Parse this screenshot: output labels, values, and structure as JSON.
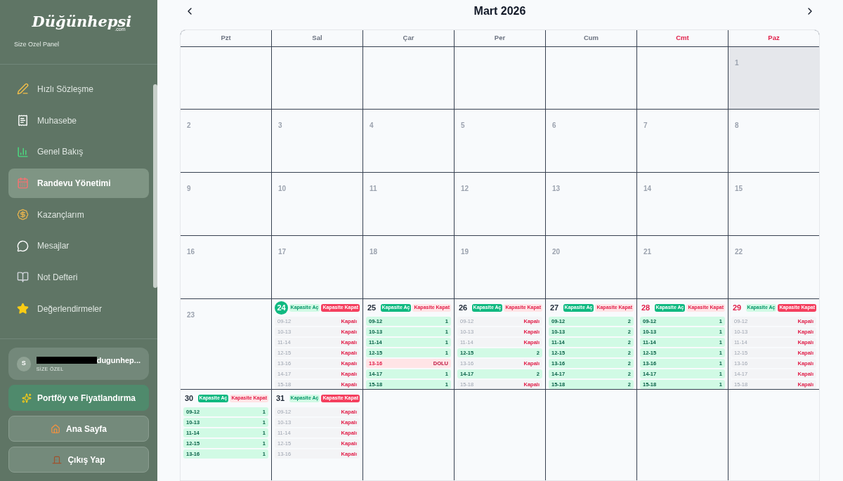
{
  "sidebar": {
    "logo": "Düğünhepsi",
    "logo_suffix": ".com",
    "subtitle": "Size Ozel Panel",
    "items": [
      {
        "label": "Hızlı Sözleşme",
        "kind": "pen",
        "selected": false
      },
      {
        "label": "Muhasebe",
        "kind": "receipt",
        "selected": false
      },
      {
        "label": "Genel Bakış",
        "kind": "chart",
        "selected": false
      },
      {
        "label": "Randevu Yönetimi",
        "kind": "calendar",
        "selected": true
      },
      {
        "label": "Kazançlarım",
        "kind": "money",
        "selected": false
      },
      {
        "label": "Mesajlar",
        "kind": "chat",
        "selected": false
      },
      {
        "label": "Not Defteri",
        "kind": "notebook",
        "selected": false
      },
      {
        "label": "Değerlendirmeler",
        "kind": "star",
        "selected": false
      }
    ],
    "user": {
      "initial": "S",
      "name": "dugunhep...",
      "role": "SİZE ÖZEL"
    },
    "buttons": [
      {
        "label": "Portföy ve Fiyatlandırma",
        "kind": "sparkles",
        "primary": true
      },
      {
        "label": "Ana Sayfa",
        "kind": "home",
        "primary": false
      },
      {
        "label": "Çıkış Yap",
        "kind": "door",
        "primary": false
      }
    ]
  },
  "calendar": {
    "title": "Mart 2026",
    "weekdays": [
      {
        "label": "Pzt",
        "weekend": false
      },
      {
        "label": "Sal",
        "weekend": false
      },
      {
        "label": "Çar",
        "weekend": false
      },
      {
        "label": "Per",
        "weekend": false
      },
      {
        "label": "Cum",
        "weekend": false
      },
      {
        "label": "Cmt",
        "weekend": true
      },
      {
        "label": "Paz",
        "weekend": true
      }
    ],
    "weeks": [
      [
        {
          "kind": "empty"
        },
        {
          "kind": "empty"
        },
        {
          "kind": "empty"
        },
        {
          "kind": "empty"
        },
        {
          "kind": "empty"
        },
        {
          "kind": "empty"
        },
        {
          "kind": "past",
          "day": "1",
          "shaded": true
        }
      ],
      [
        {
          "kind": "past",
          "day": "2",
          "shaded": false
        },
        {
          "kind": "past",
          "day": "3",
          "shaded": false
        },
        {
          "kind": "past",
          "day": "4",
          "shaded": false
        },
        {
          "kind": "past",
          "day": "5",
          "shaded": false
        },
        {
          "kind": "past",
          "day": "6",
          "shaded": false
        },
        {
          "kind": "past",
          "day": "7",
          "shaded": false
        },
        {
          "kind": "past",
          "day": "8",
          "shaded": false
        }
      ],
      [
        {
          "kind": "past",
          "day": "9",
          "shaded": false
        },
        {
          "kind": "past",
          "day": "10",
          "shaded": false
        },
        {
          "kind": "past",
          "day": "11",
          "shaded": false
        },
        {
          "kind": "past",
          "day": "12",
          "shaded": false
        },
        {
          "kind": "past",
          "day": "13",
          "shaded": false
        },
        {
          "kind": "past",
          "day": "14",
          "shaded": false
        },
        {
          "kind": "past",
          "day": "15",
          "shaded": false
        }
      ],
      [
        {
          "kind": "past",
          "day": "16",
          "shaded": false
        },
        {
          "kind": "past",
          "day": "17",
          "shaded": false
        },
        {
          "kind": "past",
          "day": "18",
          "shaded": false
        },
        {
          "kind": "past",
          "day": "19",
          "shaded": false
        },
        {
          "kind": "past",
          "day": "20",
          "shaded": false
        },
        {
          "kind": "past",
          "day": "21",
          "shaded": false
        },
        {
          "kind": "past",
          "day": "22",
          "shaded": false
        }
      ],
      [
        {
          "kind": "past",
          "day": "23",
          "shaded": false
        },
        {
          "kind": "active",
          "day": "24",
          "today": true,
          "weekend": false,
          "buttons": [
            {
              "label": "Kapasite Aç",
              "kind": "open",
              "selected": false
            },
            {
              "label": "Kapasite Kapat",
              "kind": "close",
              "selected": true
            }
          ],
          "slots": [
            {
              "time": "09-12",
              "kind": "closed",
              "value": "Kapalı"
            },
            {
              "time": "10-13",
              "kind": "closed",
              "value": "Kapalı"
            },
            {
              "time": "11-14",
              "kind": "closed",
              "value": "Kapalı"
            },
            {
              "time": "12-15",
              "kind": "closed",
              "value": "Kapalı"
            },
            {
              "time": "13-16",
              "kind": "closed",
              "value": "Kapalı"
            },
            {
              "time": "14-17",
              "kind": "closed",
              "value": "Kapalı"
            },
            {
              "time": "15-18",
              "kind": "closed",
              "value": "Kapalı"
            }
          ]
        },
        {
          "kind": "active",
          "day": "25",
          "today": false,
          "weekend": false,
          "buttons": [
            {
              "label": "Kapasite Aç",
              "kind": "open",
              "selected": true
            },
            {
              "label": "Kapasite Kapat",
              "kind": "close",
              "selected": false
            }
          ],
          "slots": [
            {
              "time": "09-12",
              "kind": "open",
              "value": "1"
            },
            {
              "time": "10-13",
              "kind": "open",
              "value": "1"
            },
            {
              "time": "11-14",
              "kind": "open",
              "value": "1"
            },
            {
              "time": "12-15",
              "kind": "open",
              "value": "1"
            },
            {
              "time": "13-16",
              "kind": "full",
              "value": "DOLU"
            },
            {
              "time": "14-17",
              "kind": "open",
              "value": "1"
            },
            {
              "time": "15-18",
              "kind": "open",
              "value": "1"
            }
          ]
        },
        {
          "kind": "active",
          "day": "26",
          "today": false,
          "weekend": false,
          "buttons": [
            {
              "label": "Kapasite Aç",
              "kind": "open",
              "selected": true
            },
            {
              "label": "Kapasite Kapat",
              "kind": "close",
              "selected": false
            }
          ],
          "slots": [
            {
              "time": "09-12",
              "kind": "closed",
              "value": "Kapalı"
            },
            {
              "time": "10-13",
              "kind": "closed",
              "value": "Kapalı"
            },
            {
              "time": "11-14",
              "kind": "closed",
              "value": "Kapalı"
            },
            {
              "time": "12-15",
              "kind": "open",
              "value": "2"
            },
            {
              "time": "13-16",
              "kind": "closed",
              "value": "Kapalı"
            },
            {
              "time": "14-17",
              "kind": "open",
              "value": "2"
            },
            {
              "time": "15-18",
              "kind": "closed",
              "value": "Kapalı"
            }
          ]
        },
        {
          "kind": "active",
          "day": "27",
          "today": false,
          "weekend": false,
          "buttons": [
            {
              "label": "Kapasite Aç",
              "kind": "open",
              "selected": true
            },
            {
              "label": "Kapasite Kapat",
              "kind": "close",
              "selected": false
            }
          ],
          "slots": [
            {
              "time": "09-12",
              "kind": "open",
              "value": "2"
            },
            {
              "time": "10-13",
              "kind": "open",
              "value": "2"
            },
            {
              "time": "11-14",
              "kind": "open",
              "value": "2"
            },
            {
              "time": "12-15",
              "kind": "open",
              "value": "2"
            },
            {
              "time": "13-16",
              "kind": "open",
              "value": "2"
            },
            {
              "time": "14-17",
              "kind": "open",
              "value": "2"
            },
            {
              "time": "15-18",
              "kind": "open",
              "value": "2"
            }
          ]
        },
        {
          "kind": "active",
          "day": "28",
          "today": false,
          "weekend": true,
          "buttons": [
            {
              "label": "Kapasite Aç",
              "kind": "open",
              "selected": true
            },
            {
              "label": "Kapasite Kapat",
              "kind": "close",
              "selected": false
            }
          ],
          "slots": [
            {
              "time": "09-12",
              "kind": "open",
              "value": "1"
            },
            {
              "time": "10-13",
              "kind": "open",
              "value": "1"
            },
            {
              "time": "11-14",
              "kind": "open",
              "value": "1"
            },
            {
              "time": "12-15",
              "kind": "open",
              "value": "1"
            },
            {
              "time": "13-16",
              "kind": "open",
              "value": "1"
            },
            {
              "time": "14-17",
              "kind": "open",
              "value": "1"
            },
            {
              "time": "15-18",
              "kind": "open",
              "value": "1"
            }
          ]
        },
        {
          "kind": "active",
          "day": "29",
          "today": false,
          "weekend": true,
          "buttons": [
            {
              "label": "Kapasite Aç",
              "kind": "open",
              "selected": false
            },
            {
              "label": "Kapasite Kapat",
              "kind": "close",
              "selected": true
            }
          ],
          "slots": [
            {
              "time": "09-12",
              "kind": "closed",
              "value": "Kapalı"
            },
            {
              "time": "10-13",
              "kind": "closed",
              "value": "Kapalı"
            },
            {
              "time": "11-14",
              "kind": "closed",
              "value": "Kapalı"
            },
            {
              "time": "12-15",
              "kind": "closed",
              "value": "Kapalı"
            },
            {
              "time": "13-16",
              "kind": "closed",
              "value": "Kapalı"
            },
            {
              "time": "14-17",
              "kind": "closed",
              "value": "Kapalı"
            },
            {
              "time": "15-18",
              "kind": "closed",
              "value": "Kapalı"
            }
          ]
        }
      ],
      [
        {
          "kind": "active",
          "day": "30",
          "today": false,
          "weekend": false,
          "buttons": [
            {
              "label": "Kapasite Aç",
              "kind": "open",
              "selected": true
            },
            {
              "label": "Kapasite Kapat",
              "kind": "close",
              "selected": false
            }
          ],
          "slots": [
            {
              "time": "09-12",
              "kind": "open",
              "value": "1"
            },
            {
              "time": "10-13",
              "kind": "open",
              "value": "1"
            },
            {
              "time": "11-14",
              "kind": "open",
              "value": "1"
            },
            {
              "time": "12-15",
              "kind": "open",
              "value": "1"
            },
            {
              "time": "13-16",
              "kind": "open",
              "value": "1"
            }
          ]
        },
        {
          "kind": "active",
          "day": "31",
          "today": false,
          "weekend": false,
          "buttons": [
            {
              "label": "Kapasite Aç",
              "kind": "open",
              "selected": false
            },
            {
              "label": "Kapasite Kapat",
              "kind": "close",
              "selected": true
            }
          ],
          "slots": [
            {
              "time": "09-12",
              "kind": "closed",
              "value": "Kapalı"
            },
            {
              "time": "10-13",
              "kind": "closed",
              "value": "Kapalı"
            },
            {
              "time": "11-14",
              "kind": "closed",
              "value": "Kapalı"
            },
            {
              "time": "12-15",
              "kind": "closed",
              "value": "Kapalı"
            },
            {
              "time": "13-16",
              "kind": "closed",
              "value": "Kapalı"
            }
          ]
        },
        {
          "kind": "empty"
        },
        {
          "kind": "empty"
        },
        {
          "kind": "empty"
        },
        {
          "kind": "empty"
        },
        {
          "kind": "empty"
        }
      ]
    ]
  }
}
